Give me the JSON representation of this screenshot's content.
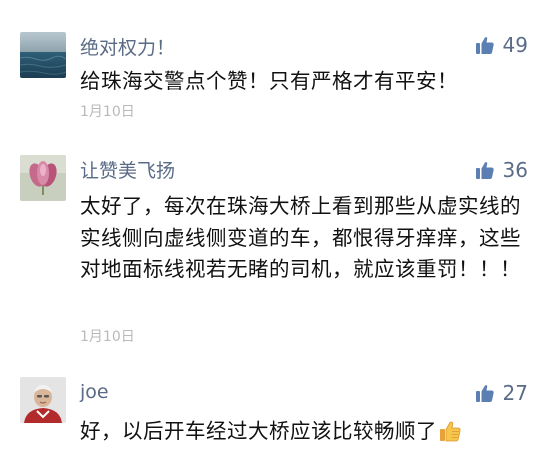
{
  "comments": [
    {
      "user": "绝对权力！",
      "likes": "49",
      "text": "给珠海交警点个赞！只有严格才有平安！",
      "date": "1月10日",
      "avatar_icon": "ocean-avatar"
    },
    {
      "user": "让赞美飞扬",
      "likes": "36",
      "text": "太好了，每次在珠海大桥上看到那些从虚实线的实线侧向虚线侧变道的车，都恨得牙痒痒，这些对地面标线视若无睹的司机，就应该重罚！！！",
      "date": "1月10日",
      "avatar_icon": "flower-avatar"
    },
    {
      "user": "joe",
      "likes": "27",
      "text": "好，以后开车经过大桥应该比较畅顺了",
      "avatar_icon": "person-avatar",
      "trailing_emoji": "thumbs-up-emoji"
    }
  ],
  "colors": {
    "name": "#5a6b86",
    "text": "#111111",
    "date": "#b9b9b9",
    "like_icon": "#5b7fb2"
  }
}
